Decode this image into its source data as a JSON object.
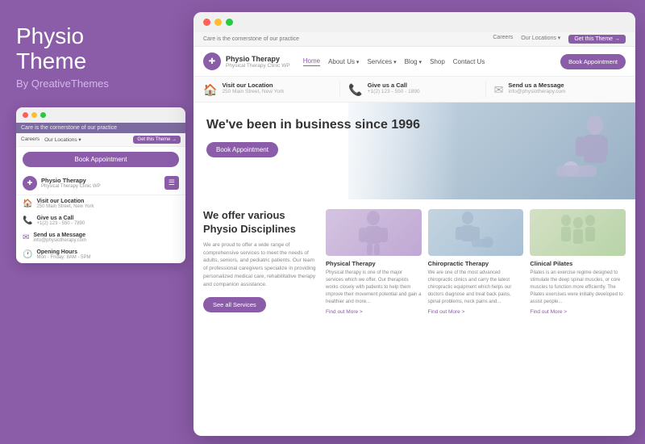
{
  "brand": {
    "title_bold": "Physio",
    "title_regular": "Theme",
    "by": "By QreativeThemes"
  },
  "mini_browser": {
    "topbar_text": "Care is the cornerstone of our practice",
    "nav_links": [
      "Careers",
      "Our Locations ▾",
      "Get this Theme →"
    ],
    "book_btn": "Book Appointment",
    "brand_name": "Physio Therapy",
    "brand_sub": "Physical Therapy Clinic WP",
    "info_items": [
      {
        "icon": "🏠",
        "title": "Visit our Location",
        "sub": "250 Main Street, New York"
      },
      {
        "icon": "📞",
        "title": "Give us a Call",
        "sub": "+1(2) 123 - 550 - 7890"
      },
      {
        "icon": "✉",
        "title": "Send us a Message",
        "sub": "info@physiotherapy.com"
      },
      {
        "icon": "🕐",
        "title": "Opening Hours",
        "sub": "Mon - Friday: 8AM - 5PM"
      }
    ]
  },
  "site": {
    "topbar_text": "Care is the cornerstone of our practice",
    "topbar_links": [
      "Careers",
      "Our Locations ▾",
      "Get this Theme →"
    ],
    "nav": {
      "logo_name": "Physio Therapy",
      "logo_sub": "Physical Therapy Clinic WP",
      "links": [
        "Home",
        "About Us",
        "Services",
        "Blog",
        "Shop",
        "Contact Us"
      ],
      "active_link": "Home",
      "book_btn": "Book Appointment"
    },
    "info_bar": [
      {
        "icon": "🏠",
        "title": "Visit our Location",
        "sub": "250 Main Street, New York"
      },
      {
        "icon": "📞",
        "title": "Give us a Call",
        "sub": "+1(2) 123 - 550 - 1890"
      },
      {
        "icon": "✉",
        "title": "Send us a Message",
        "sub": "info@physiotherapy.com"
      }
    ],
    "hero": {
      "heading": "We've been in business since 1996",
      "cta": "Book Appointment"
    },
    "main_section": {
      "heading": "We offer various Physio Disciplines",
      "body": "We are proud to offer a wide range of comprehensive services to meet the needs of adults, seniors, and pediatric patients. Our team of professional caregivers specialize in providing personalized medical care, rehabilitative therapy and companion assistance.",
      "cta": "See all Services"
    },
    "cards": [
      {
        "title": "Physical Therapy",
        "body": "Physical therapy is one of the major services which we offer. Our therapists works closely with patients to help them improve their movement potential and gain a healthier and more...",
        "link": "Find out More"
      },
      {
        "title": "Chiropractic Therapy",
        "body": "We are one of the most advanced chiropractic clinics and carry the latest chiropractic equipment which helps our doctors diagnose and treat back pains, spinal problems, neck pains and...",
        "link": "Find out More"
      },
      {
        "title": "Clinical Pilates",
        "body": "Pilates is an exercise regime designed to stimulate the deep spinal muscles, or core muscles to function more efficiently. The Pilates exercises were initially developed to assist people...",
        "link": "Find out More"
      }
    ]
  },
  "colors": {
    "purple": "#8b5ca8",
    "light_purple": "#d4b8e8"
  }
}
